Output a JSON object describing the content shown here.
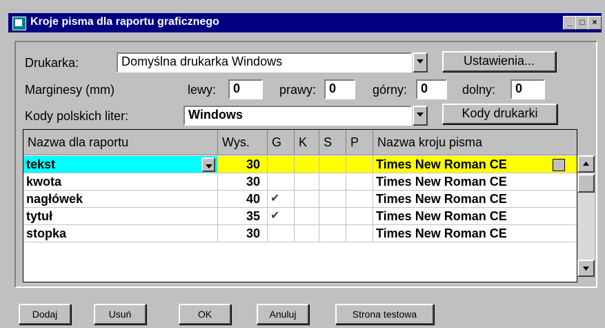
{
  "window": {
    "title": "Kroje pisma dla raportu graficznego",
    "min_label": "_",
    "max_label": "□",
    "close_label": "×"
  },
  "printer": {
    "label": "Drukarka:",
    "value": "Domyślna drukarka Windows",
    "settings_button": "Ustawienia..."
  },
  "margins": {
    "label": "Marginesy (mm)",
    "left_label": "lewy:",
    "left_value": "0",
    "right_label": "prawy:",
    "right_value": "0",
    "top_label": "górny:",
    "top_value": "0",
    "bottom_label": "dolny:",
    "bottom_value": "0"
  },
  "codes": {
    "label": "Kody polskich liter:",
    "value": "Windows",
    "printer_codes_button": "Kody drukarki"
  },
  "table": {
    "headers": [
      "Nazwa dla raportu",
      "Wys.",
      "G",
      "K",
      "S",
      "P",
      "Nazwa kroju pisma"
    ],
    "rows": [
      {
        "name": "tekst",
        "height": "30",
        "g": "",
        "k": "",
        "s": "",
        "p": "",
        "font": "Times New Roman CE",
        "selected": true
      },
      {
        "name": "kwota",
        "height": "30",
        "g": "",
        "k": "",
        "s": "",
        "p": "",
        "font": "Times New Roman CE"
      },
      {
        "name": "nagłówek",
        "height": "40",
        "g": "✔",
        "k": "",
        "s": "",
        "p": "",
        "font": "Times New Roman CE"
      },
      {
        "name": "tytuł",
        "height": "35",
        "g": "✔",
        "k": "",
        "s": "",
        "p": "",
        "font": "Times New Roman CE"
      },
      {
        "name": "stopka",
        "height": "30",
        "g": "",
        "k": "",
        "s": "",
        "p": "",
        "font": "Times New Roman CE"
      }
    ]
  },
  "buttons": {
    "add": "Dodaj",
    "remove": "Usuń",
    "ok": "OK",
    "cancel": "Anuluj",
    "test_page": "Strona testowa"
  },
  "colors": {
    "title_bar": "#000080",
    "selected_name": "#00ffff",
    "selected_row": "#ffff00"
  }
}
